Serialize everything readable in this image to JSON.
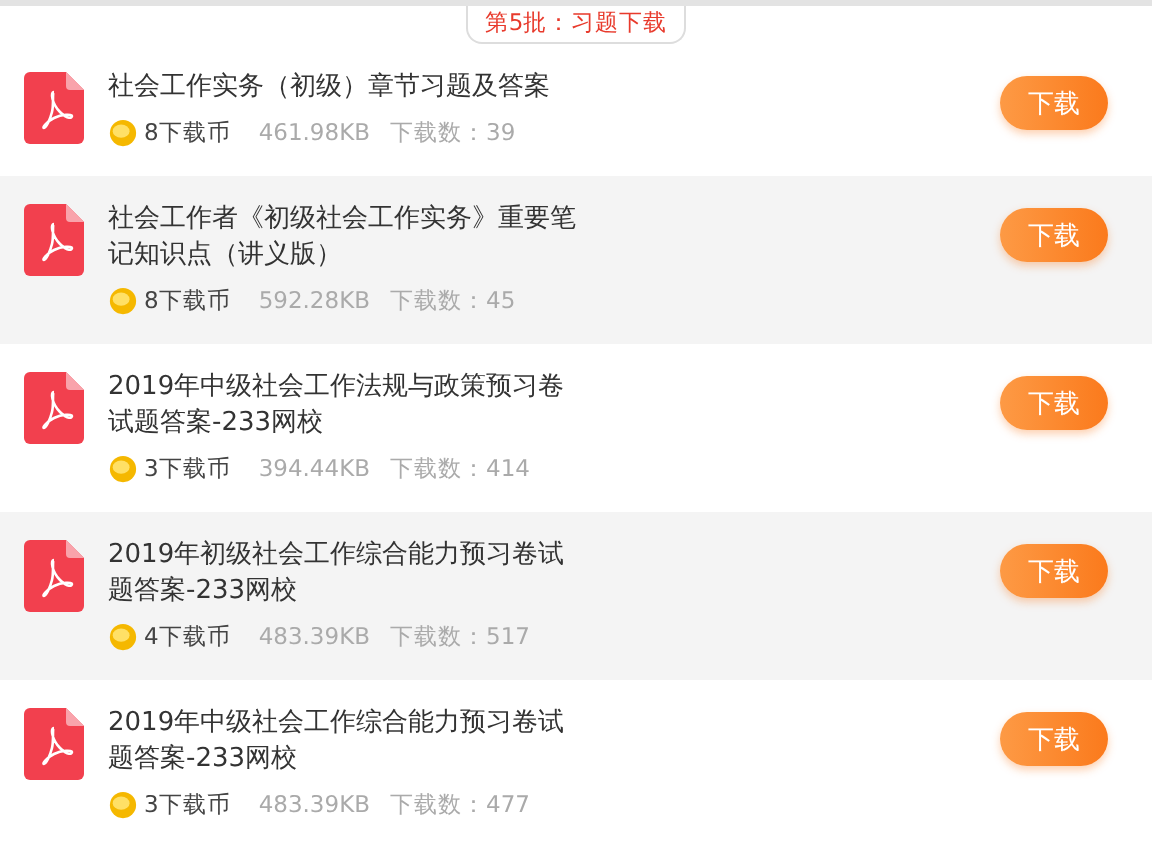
{
  "header": {
    "label": "第5批：习题下载"
  },
  "files": [
    {
      "title": "社会工作实务（初级）章节习题及答案",
      "price": "8下载币",
      "size": "461.98KB",
      "downloads": "下载数：39",
      "button": "下载"
    },
    {
      "title": "社会工作者《初级社会工作实务》重要笔记知识点（讲义版）",
      "price": "8下载币",
      "size": "592.28KB",
      "downloads": "下载数：45",
      "button": "下载"
    },
    {
      "title": "2019年中级社会工作法规与政策预习卷试题答案-233网校",
      "price": "3下载币",
      "size": "394.44KB",
      "downloads": "下载数：414",
      "button": "下载"
    },
    {
      "title": "2019年初级社会工作综合能力预习卷试题答案-233网校",
      "price": "4下载币",
      "size": "483.39KB",
      "downloads": "下载数：517",
      "button": "下载"
    },
    {
      "title": "2019年中级社会工作综合能力预习卷试题答案-233网校",
      "price": "3下载币",
      "size": "483.39KB",
      "downloads": "下载数：477",
      "button": "下载"
    }
  ]
}
